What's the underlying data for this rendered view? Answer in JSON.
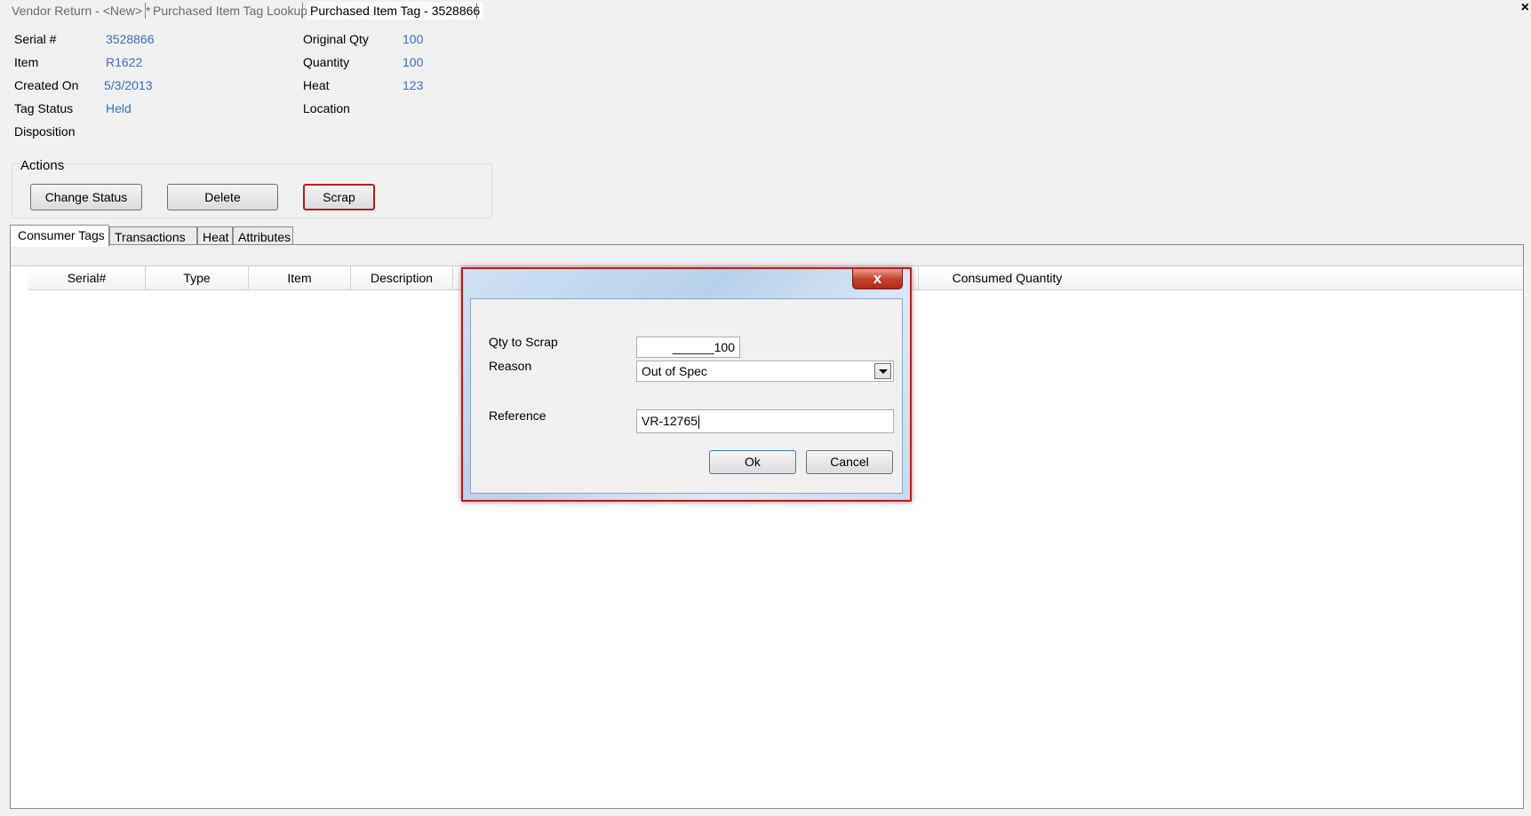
{
  "doc_tabs": [
    {
      "label": "Vendor Return - <New> *"
    },
    {
      "label": "Purchased Item Tag Lookup"
    },
    {
      "label": "Purchased Item Tag - 3528866"
    }
  ],
  "close_glyph": "×",
  "fields": {
    "serial": {
      "label": "Serial #",
      "value": "3528866"
    },
    "item": {
      "label": "Item",
      "value": "R1622"
    },
    "created_on": {
      "label": "Created On",
      "value": "5/3/2013"
    },
    "tag_status": {
      "label": "Tag Status",
      "value": "Held"
    },
    "disposition": {
      "label": "Disposition",
      "value": ""
    },
    "original_qty": {
      "label": "Original Qty",
      "value": "100"
    },
    "quantity": {
      "label": "Quantity",
      "value": "100"
    },
    "heat": {
      "label": "Heat",
      "value": "123"
    },
    "location": {
      "label": "Location",
      "value": ""
    }
  },
  "actions": {
    "title": "Actions",
    "change_status": "Change Status",
    "delete": "Delete",
    "scrap": "Scrap"
  },
  "tabs": [
    {
      "label": "Consumer Tags",
      "active": true
    },
    {
      "label": "Transactions"
    },
    {
      "label": "Heat"
    },
    {
      "label": "Attributes"
    }
  ],
  "grid": {
    "columns": [
      "Serial#",
      "Type",
      "Item",
      "Description",
      "Consumed Quantity"
    ]
  },
  "dialog": {
    "close_glyph": "x",
    "qty_label": "Qty to Scrap",
    "qty_value": "______100",
    "reason_label": "Reason",
    "reason_value": "Out of Spec",
    "reference_label": "Reference",
    "reference_value": "VR-12765",
    "ok": "Ok",
    "cancel": "Cancel"
  },
  "colors": {
    "value_text": "#3a6fc4",
    "highlight_border": "#b81d1d"
  }
}
